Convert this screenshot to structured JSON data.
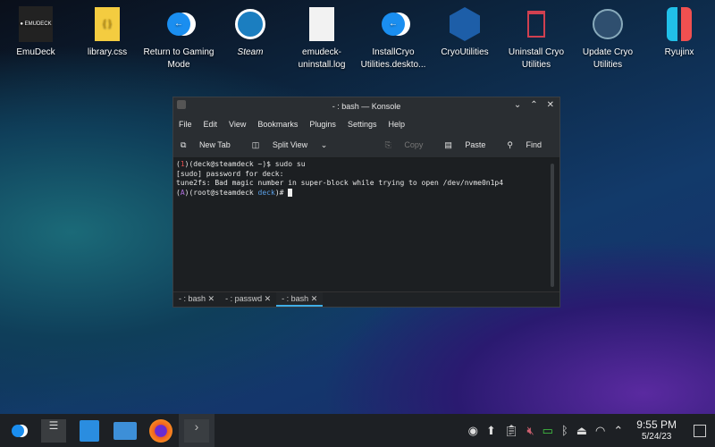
{
  "desktop": {
    "icons": [
      {
        "label": "EmuDeck"
      },
      {
        "label": "library.css"
      },
      {
        "label": "Return to Gaming Mode"
      },
      {
        "label": "Steam"
      },
      {
        "label": "emudeck-uninstall.log"
      },
      {
        "label": "InstallCryo Utilities.deskto..."
      },
      {
        "label": "CryoUtilities"
      },
      {
        "label": "Uninstall Cryo Utilities"
      },
      {
        "label": "Update Cryo Utilities"
      },
      {
        "label": "Ryujinx"
      }
    ]
  },
  "window": {
    "title": "- : bash — Konsole",
    "menu": [
      "File",
      "Edit",
      "View",
      "Bookmarks",
      "Plugins",
      "Settings",
      "Help"
    ],
    "toolbar": {
      "new_tab": "New Tab",
      "split_view": "Split View",
      "copy": "Copy",
      "paste": "Paste",
      "find": "Find"
    },
    "terminal": {
      "lines": [
        {
          "p1": "(",
          "n": "1",
          "p2": ")(deck@steamdeck ~)$ sudo su"
        },
        {
          "text": "[sudo] password for deck:"
        },
        {
          "text": "tune2fs: Bad magic number in super-block while trying to open /dev/nvme0n1p4"
        },
        {
          "p1": "(",
          "n": "A",
          "p2": ")(root@steamdeck ",
          "d": "deck",
          "p3": ")#"
        }
      ]
    },
    "tabs": [
      "- : bash",
      "- : passwd",
      "- : bash"
    ]
  },
  "taskbar": {
    "time": "9:55 PM",
    "date": "5/24/23"
  },
  "colors": {
    "accent": "#3daee9",
    "term_red": "#e05050",
    "term_purple": "#b070e0",
    "term_blue": "#5aa0e8"
  }
}
